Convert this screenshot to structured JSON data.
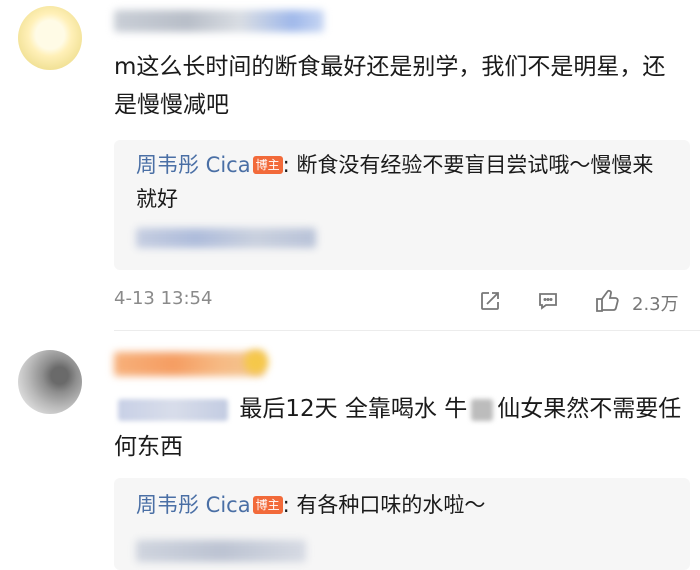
{
  "comments": [
    {
      "text": "m这么长时间的断食最好还是别学，我们不是明星，还是慢慢减吧",
      "reply": {
        "author": "周韦彤 Cica",
        "badge": "博主",
        "separator": ":",
        "text": "断食没有经验不要盲目尝试哦～慢慢来就好"
      },
      "timestamp": "4-13 13:54",
      "likes": "2.3万"
    },
    {
      "text_part1": "最后12天 全靠喝水 牛",
      "text_part2": "仙女果然不需要任何东西",
      "reply": {
        "author": "周韦彤 Cica",
        "badge": "博主",
        "separator": ":",
        "text": "有各种口味的水啦～"
      }
    }
  ],
  "icons": {
    "share": "share-icon",
    "comment": "comment-icon",
    "like": "thumbs-up-icon"
  }
}
